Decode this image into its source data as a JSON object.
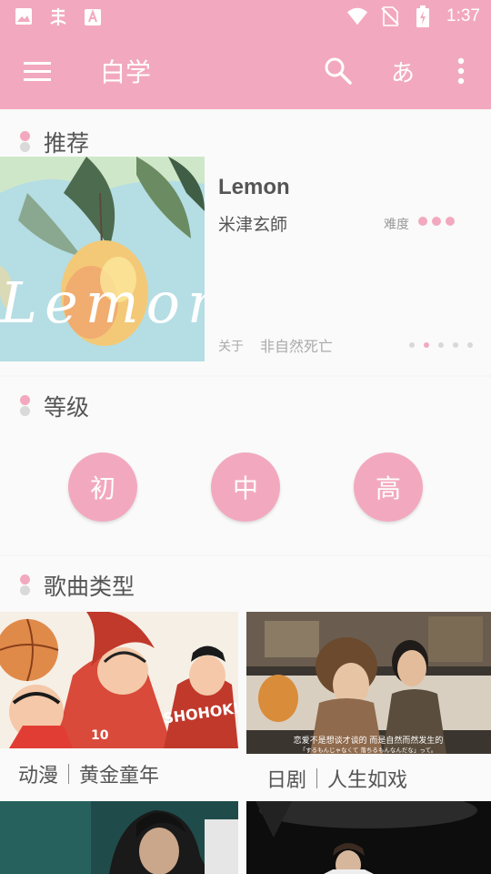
{
  "status_bar": {
    "icons": [
      "image-icon",
      "app-bug-icon",
      "store-icon",
      "wifi-icon",
      "no-sim-icon",
      "battery-charging-icon"
    ],
    "time": "1:37"
  },
  "app_bar": {
    "title": "白学",
    "lang_glyph": "あ",
    "actions": [
      "menu-icon",
      "search-icon",
      "more-vert-icon"
    ]
  },
  "recommend": {
    "section_title": "推荐",
    "song": {
      "title": "Lemon",
      "artist": "米津玄師",
      "difficulty_label": "难度",
      "difficulty_level": 3,
      "about_label": "关于",
      "about_value": "非自然死亡",
      "cover_text": "Lemon"
    },
    "pager": {
      "count": 5,
      "active": 1
    }
  },
  "levels": {
    "section_title": "等级",
    "items": [
      {
        "label": "初"
      },
      {
        "label": "中"
      },
      {
        "label": "高"
      }
    ]
  },
  "genres": {
    "section_title": "歌曲类型",
    "items": [
      {
        "category": "动漫",
        "subtitle": "黄金童年"
      },
      {
        "category": "日剧",
        "subtitle": "人生如戏",
        "caption_cn": "恋爱不是想谈才谈的 而是自然而然发生的",
        "caption_jp": "「するもんじゃなくて 落ちるもんなんだな」って。"
      }
    ]
  },
  "colors": {
    "accent": "#f2a9bf",
    "text": "#555555",
    "muted": "#aaaaaa"
  }
}
